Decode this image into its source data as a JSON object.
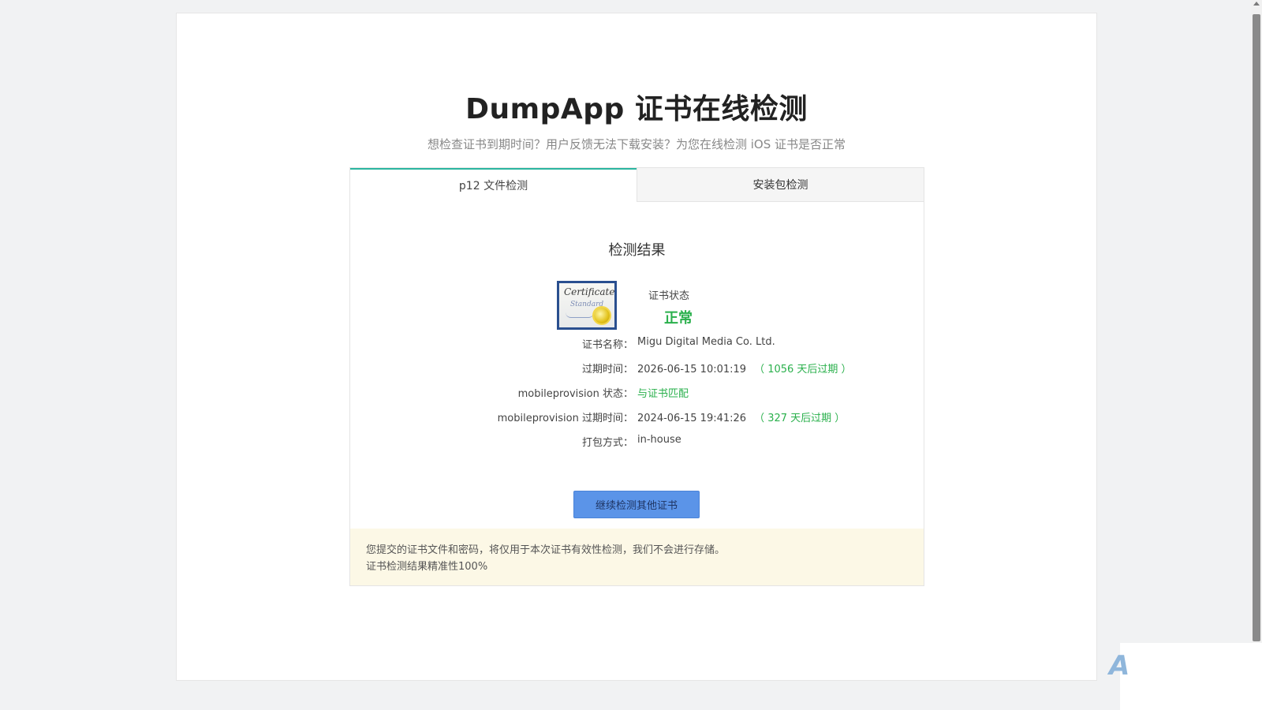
{
  "header": {
    "title": "DumpApp 证书在线检测",
    "subtitle": "想检查证书到期时间？用户反馈无法下载安装？为您在线检测 iOS 证书是否正常"
  },
  "tabs": [
    {
      "label": "p12 文件检测",
      "active": true
    },
    {
      "label": "安装包检测",
      "active": false
    }
  ],
  "result": {
    "title": "检测结果",
    "certificate_icon": {
      "name": "certificate-icon",
      "line1": "Certificate",
      "line2": "Standard"
    },
    "status_label": "证书状态",
    "status_value": "正常",
    "rows": [
      {
        "key": "证书名称：",
        "value": "Migu Digital Media Co. Ltd.",
        "extra": ""
      },
      {
        "key": "过期时间：",
        "value": "2026-06-15 10:01:19",
        "extra": "（ 1056 天后过期 ）"
      },
      {
        "key": "mobileprovision 状态：",
        "value": "与证书匹配",
        "extra": ""
      },
      {
        "key": "mobileprovision 过期时间：",
        "value": "2024-06-15 19:41:26",
        "extra": "（ 327 天后过期 ）"
      },
      {
        "key": "打包方式：",
        "value": "in-house",
        "extra": ""
      }
    ],
    "continue_button": "继续检测其他证书"
  },
  "notice": {
    "line1": "您提交的证书文件和密码，将仅用于本次证书有效性检测，我们不会进行存储。",
    "line2": "证书检测结果精准性100%"
  },
  "colors": {
    "accent_tab": "#2bb5a0",
    "success_green": "#2ab04c",
    "button_blue": "#5b94e8",
    "notice_bg": "#fcf8e6"
  },
  "corner_glyph": "A"
}
